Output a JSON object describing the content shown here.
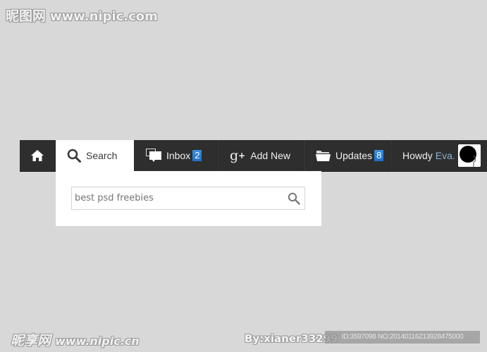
{
  "watermarks": {
    "top_logo": "昵图网",
    "top_url": "www.nipic.com",
    "bottom_logo": "昵享网",
    "bottom_url": "www.nipic.cn",
    "author": "By:xianer33299",
    "id_line": "ID:3597098 NO:20140116213928475000"
  },
  "navbar": {
    "home": {
      "icon": "home-icon"
    },
    "search": {
      "label": "Search",
      "icon": "search-icon",
      "active": true
    },
    "inbox": {
      "label": "Inbox",
      "icon": "chat-bubbles-icon",
      "badge": "2"
    },
    "add_new": {
      "label": "Add New",
      "icon": "google-plus-icon"
    },
    "updates": {
      "label": "Updates",
      "icon": "folder-icon",
      "badge": "8"
    },
    "user": {
      "greeting": "Howdy",
      "name": "Eva.",
      "avatar": "avatar-silhouette"
    }
  },
  "search_dropdown": {
    "input_value": "",
    "input_placeholder": "best psd freebies",
    "submit_icon": "search-icon"
  },
  "colors": {
    "background": "#d8d8d8",
    "navbar": "#2e2e2e",
    "badge": "#2a7fd4",
    "username": "#8fb3d6"
  }
}
